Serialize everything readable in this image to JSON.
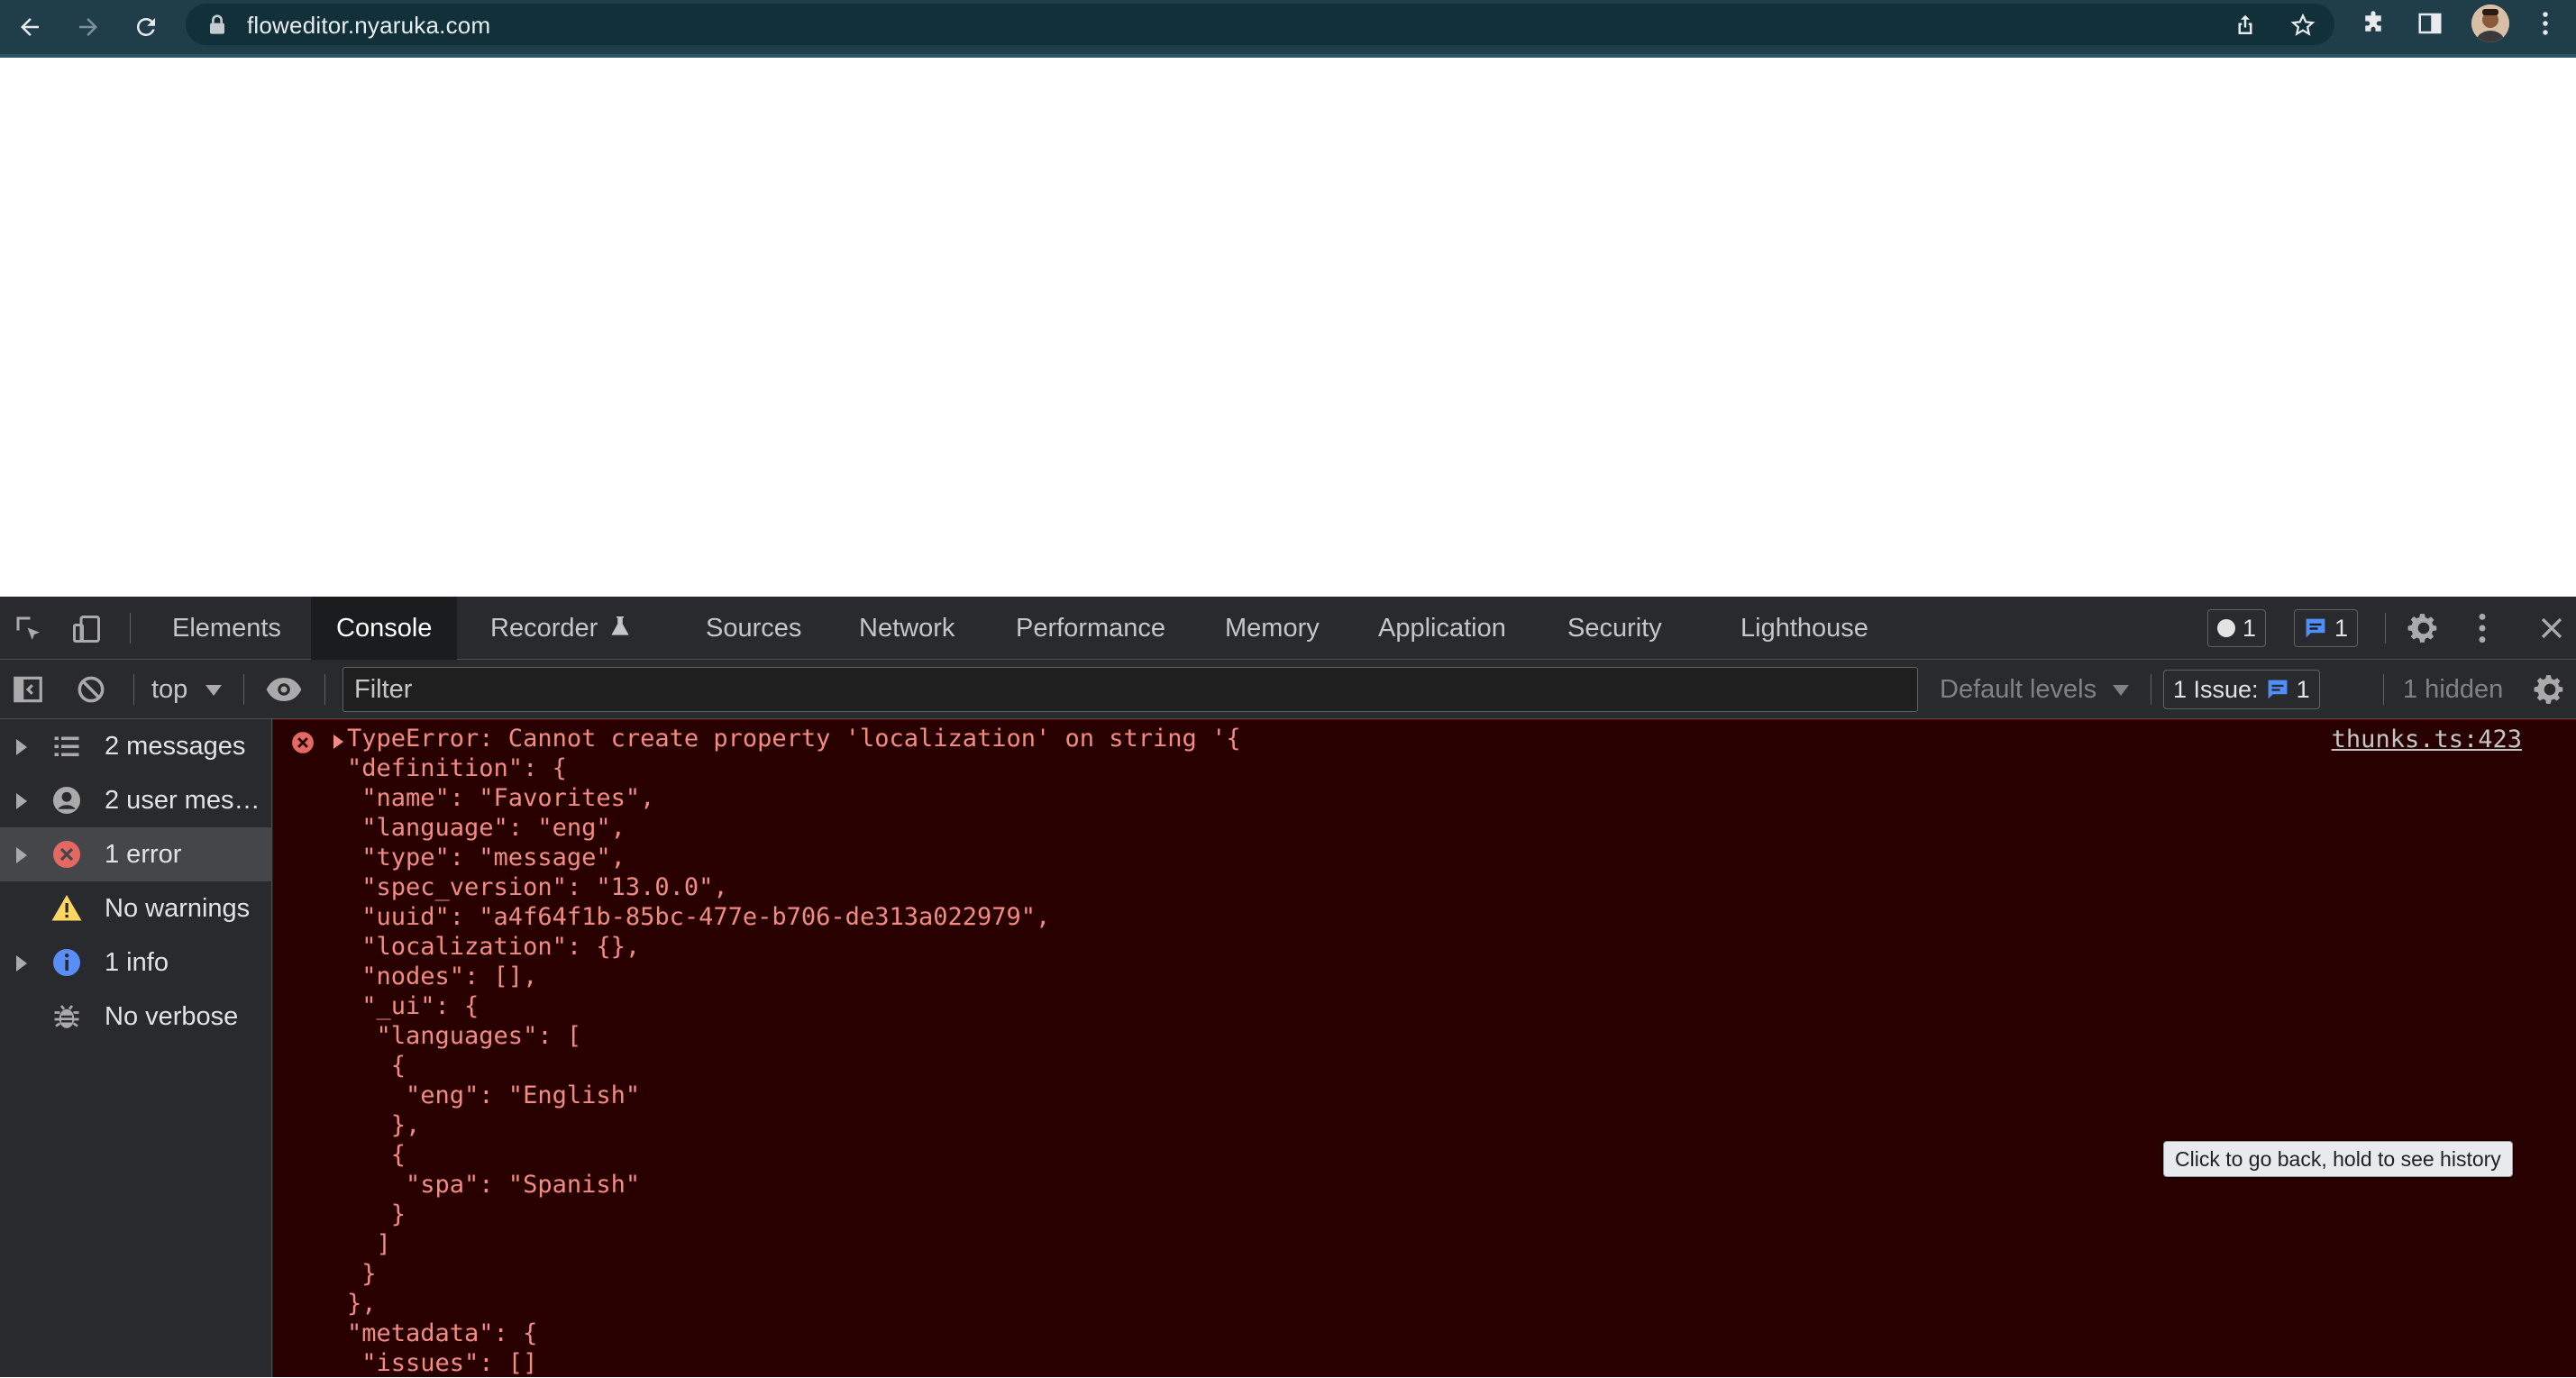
{
  "browser": {
    "url": "floweditor.nyaruka.com",
    "icons": [
      "back-arrow-icon",
      "forward-arrow-icon",
      "reload-icon",
      "lock-icon",
      "share-icon",
      "bookmark-star-icon",
      "extensions-puzzle-icon",
      "side-panel-icon",
      "avatar",
      "more-vert-icon"
    ]
  },
  "devtools": {
    "tabs": [
      "Elements",
      "Console",
      "Recorder",
      "Sources",
      "Network",
      "Performance",
      "Memory",
      "Application",
      "Security",
      "Lighthouse"
    ],
    "active_tab": "Console",
    "badges": {
      "errors": "1",
      "messages": "1"
    },
    "toolbar": {
      "context": "top",
      "filter_placeholder": "Filter",
      "levels": "Default levels",
      "issues_label": "1 Issue:",
      "issues_count": "1",
      "hidden": "1 hidden"
    },
    "sidebar": [
      {
        "label": "2 messages",
        "icon": "list-icon",
        "expandable": true
      },
      {
        "label": "2 user mes…",
        "icon": "user-circle-icon",
        "expandable": true
      },
      {
        "label": "1 error",
        "icon": "error-circle-icon",
        "expandable": true,
        "active": true
      },
      {
        "label": "No warnings",
        "icon": "warning-triangle-icon",
        "expandable": false
      },
      {
        "label": "1 info",
        "icon": "info-circle-icon",
        "expandable": true
      },
      {
        "label": "No verbose",
        "icon": "bug-icon",
        "expandable": false
      }
    ],
    "console": {
      "error_message": "TypeError: Cannot create property 'localization' on string '{\n\"definition\": {\n \"name\": \"Favorites\",\n \"language\": \"eng\",\n \"type\": \"message\",\n \"spec_version\": \"13.0.0\",\n \"uuid\": \"a4f64f1b-85bc-477e-b706-de313a022979\",\n \"localization\": {},\n \"nodes\": [],\n \"_ui\": {\n  \"languages\": [\n   {\n    \"eng\": \"English\"\n   },\n   {\n    \"spa\": \"Spanish\"\n   }\n  ]\n }\n},\n\"metadata\": {\n \"issues\": []",
      "source": "thunks.ts:423"
    },
    "tooltip": "Click to go back, hold to see history",
    "colors": {
      "error_bg": "#290000",
      "error_text": "#f28b82",
      "panel_bg": "#292a2d",
      "browser_bar": "#1f3e4a"
    }
  }
}
